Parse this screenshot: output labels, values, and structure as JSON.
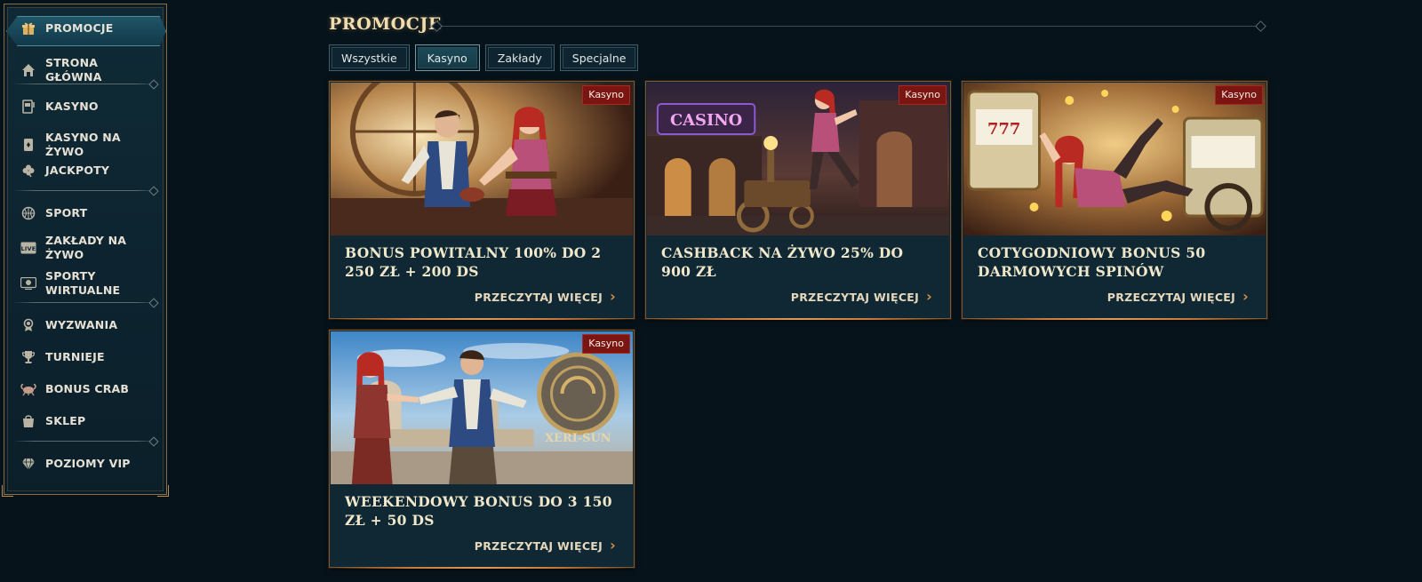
{
  "sidebar": {
    "items": [
      {
        "label": "PROMOCJE",
        "icon": "gift-icon",
        "active": true
      },
      {
        "label": "STRONA GŁÓWNA",
        "icon": "home-icon"
      },
      {
        "label": "KASYNO",
        "icon": "slot-machine-icon"
      },
      {
        "label": "KASYNO NA ŻYWO",
        "icon": "playing-card-icon"
      },
      {
        "label": "JACKPOTY",
        "icon": "clover-icon"
      },
      {
        "label": "SPORT",
        "icon": "basketball-icon"
      },
      {
        "label": "ZAKŁADY NA ŻYWO",
        "icon": "live-icon"
      },
      {
        "label": "SPORTY WIRTUALNE",
        "icon": "virtual-sports-icon"
      },
      {
        "label": "WYZWANIA",
        "icon": "medal-icon"
      },
      {
        "label": "TURNIEJE",
        "icon": "trophy-icon"
      },
      {
        "label": "BONUS CRAB",
        "icon": "crab-icon"
      },
      {
        "label": "SKLEP",
        "icon": "shopping-bag-icon"
      },
      {
        "label": "POZIOMY VIP",
        "icon": "diamond-icon"
      }
    ],
    "live_icon_text": "LIVE"
  },
  "header": {
    "title": "PROMOCJE"
  },
  "tabs": [
    {
      "label": "Wszystkie",
      "active": false
    },
    {
      "label": "Kasyno",
      "active": true
    },
    {
      "label": "Zakłady",
      "active": false
    },
    {
      "label": "Specjalne",
      "active": false
    }
  ],
  "cards": [
    {
      "badge": "Kasyno",
      "title": "BONUS POWITALNY 100% DO 2 250 ZŁ + 200 DS",
      "link": "PRZECZYTAJ WIĘCEJ"
    },
    {
      "badge": "Kasyno",
      "title": "CASHBACK NA ŻYWO 25% DO 900 ZŁ",
      "link": "PRZECZYTAJ WIĘCEJ",
      "sign_text": "CASINO"
    },
    {
      "badge": "Kasyno",
      "title": "COTYGODNIOWY BONUS 50 DARMOWYCH SPINÓW",
      "link": "PRZECZYTAJ WIĘCEJ",
      "reel_text": "777"
    },
    {
      "badge": "Kasyno",
      "title": "WEEKENDOWY BONUS DO 3 150 ZŁ + 50 DS",
      "link": "PRZECZYTAJ WIĘCEJ",
      "logo_text": "XERI-SUN"
    }
  ],
  "colors": {
    "background": "#07131b",
    "card": "#0f2833",
    "badge": "#7b1512",
    "accent": "#d3904d",
    "title": "#f1dcae"
  }
}
